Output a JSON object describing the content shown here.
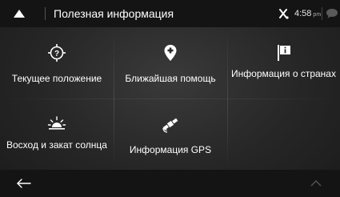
{
  "header": {
    "title": "Полезная информация",
    "clock_time": "4:58",
    "clock_suffix": "pm",
    "up_icon": "triangle-up-icon",
    "gps_icon": "gps-no-signal-icon",
    "message_icon": "speech-bubble-icon"
  },
  "tiles": [
    {
      "label": "Текущее положение",
      "icon": "location-question-icon"
    },
    {
      "label": "Ближайшая помощь",
      "icon": "map-pin-medical-icon"
    },
    {
      "label": "Информация о странах",
      "icon": "flag-info-icon"
    },
    {
      "label": "Восход и закат солнца",
      "icon": "sunrise-icon"
    },
    {
      "label": "Информация GPS",
      "icon": "satellite-icon"
    }
  ],
  "footer": {
    "back_icon": "back-arrow-icon",
    "scroll_icon": "chevron-up-icon"
  },
  "colors": {
    "bar_background": "#141414",
    "panel_background": "#262626",
    "text": "#ffffff"
  }
}
